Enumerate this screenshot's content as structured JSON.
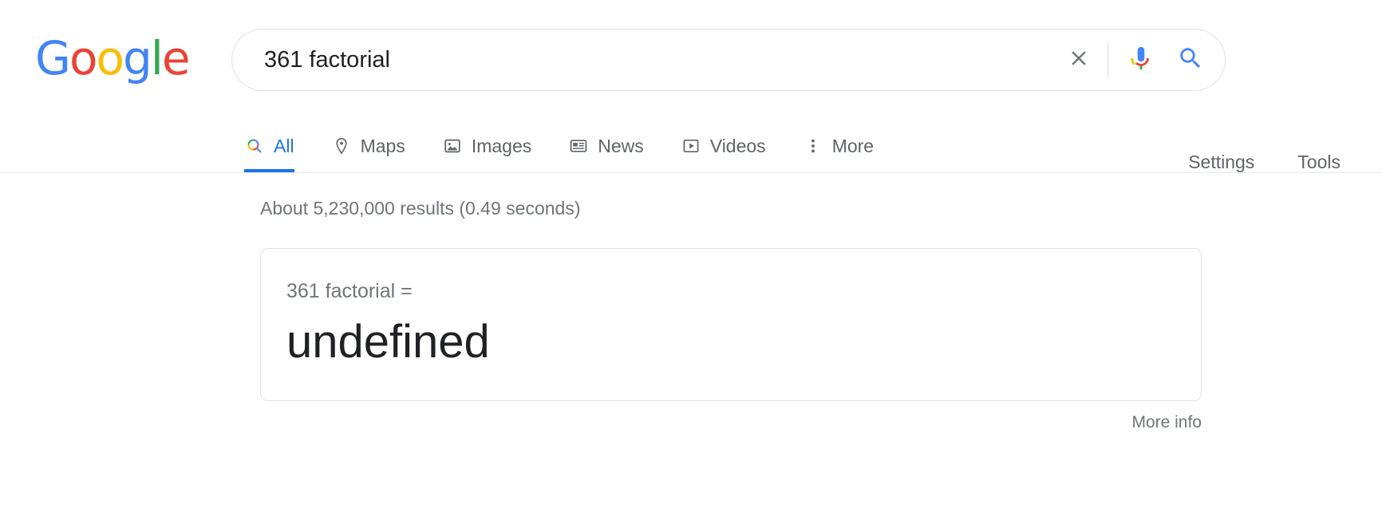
{
  "brand": {
    "logo_letters": [
      "G",
      "o",
      "o",
      "g",
      "l",
      "e"
    ],
    "colors": {
      "blue": "#4285F4",
      "red": "#EA4335",
      "yellow": "#FBBC05",
      "green": "#34A853",
      "link_blue": "#1a73e8",
      "grey_text": "#5f6368",
      "stats_grey": "#70757a"
    }
  },
  "search": {
    "query": "361 factorial",
    "placeholder": "Search",
    "clear_icon": "close-icon",
    "mic_icon": "microphone-icon",
    "search_icon": "search-icon"
  },
  "nav": {
    "tabs": [
      {
        "label": "All",
        "icon": "search-icon",
        "active": true
      },
      {
        "label": "Maps",
        "icon": "map-pin-icon",
        "active": false
      },
      {
        "label": "Images",
        "icon": "image-icon",
        "active": false
      },
      {
        "label": "News",
        "icon": "news-icon",
        "active": false
      },
      {
        "label": "Videos",
        "icon": "video-play-icon",
        "active": false
      },
      {
        "label": "More",
        "icon": "kebab-menu-icon",
        "active": false
      }
    ],
    "settings_label": "Settings",
    "tools_label": "Tools"
  },
  "results": {
    "stats": "About 5,230,000 results (0.49 seconds)"
  },
  "calculator": {
    "expression": "361 factorial =",
    "answer": "undefined",
    "more_info_label": "More info"
  }
}
